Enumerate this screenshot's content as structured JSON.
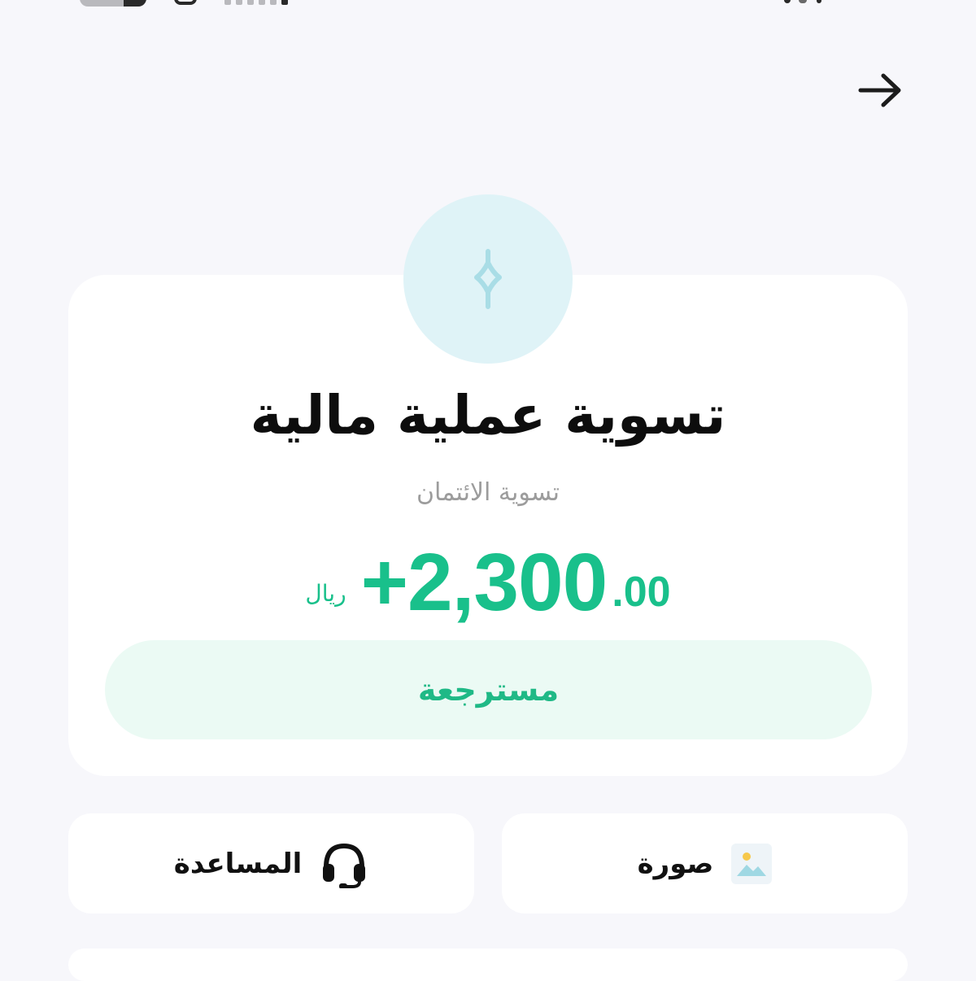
{
  "header": {
    "back_icon": "arrow-right-icon"
  },
  "transaction": {
    "icon": "sparkle-icon",
    "title": "تسوية عملية مالية",
    "subtitle": "تسوية الائتمان",
    "amount_main": "+2,300",
    "amount_cents": ".00",
    "currency": "ريال",
    "status": "مسترجعة"
  },
  "actions": {
    "photo_label": "صورة",
    "photo_icon": "image-icon",
    "help_label": "المساعدة",
    "help_icon": "headset-icon"
  },
  "colors": {
    "accent_green": "#19c08b",
    "status_bg": "#ebfaf4",
    "avatar_bg": "#dff3f7",
    "page_bg": "#f7f7fb"
  }
}
